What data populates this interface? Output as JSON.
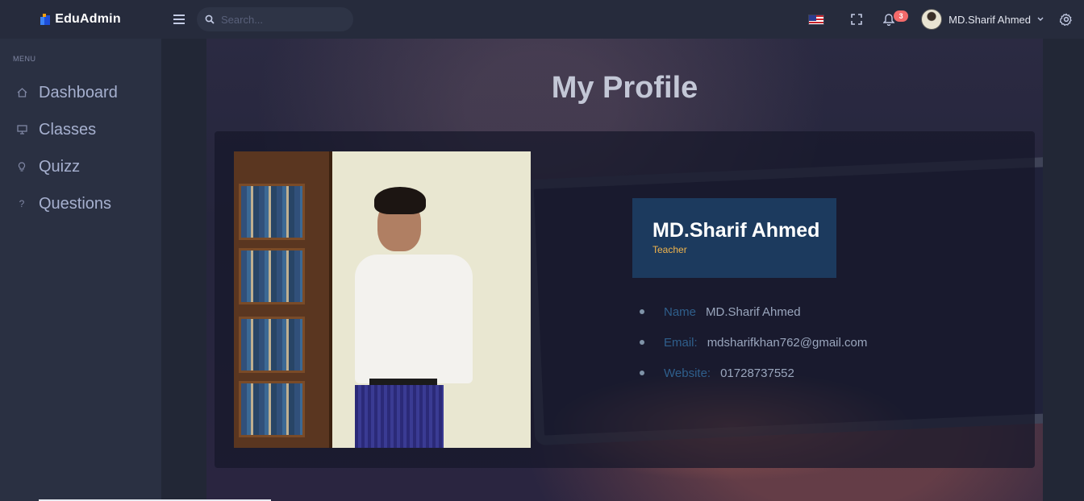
{
  "app": {
    "brand": "EduAdmin"
  },
  "header": {
    "search": {
      "placeholder": "Search...",
      "value": ""
    },
    "language_flag": "us-flag",
    "notifications": {
      "count": "3"
    },
    "user": {
      "name": "MD.Sharif Ahmed"
    }
  },
  "sidebar": {
    "menu_title": "MENU",
    "items": [
      {
        "label": "Dashboard",
        "icon": "home-icon"
      },
      {
        "label": "Classes",
        "icon": "monitor-icon"
      },
      {
        "label": "Quizz",
        "icon": "lightbulb-icon"
      },
      {
        "label": "Questions",
        "icon": "question-icon"
      }
    ]
  },
  "main": {
    "title": "My Profile",
    "profile": {
      "name": "MD.Sharif Ahmed",
      "role": "Teacher",
      "fields": [
        {
          "label": "Name",
          "value": "MD.Sharif Ahmed"
        },
        {
          "label": "Email:",
          "value": "mdsharifkhan762@gmail.com"
        },
        {
          "label": "Website:",
          "value": "01728737552"
        }
      ]
    }
  },
  "colors": {
    "accent": "#f1b44c",
    "badge": "#f46a6a",
    "name_box": "#1c3a5e",
    "sidebar": "#2a3042"
  }
}
